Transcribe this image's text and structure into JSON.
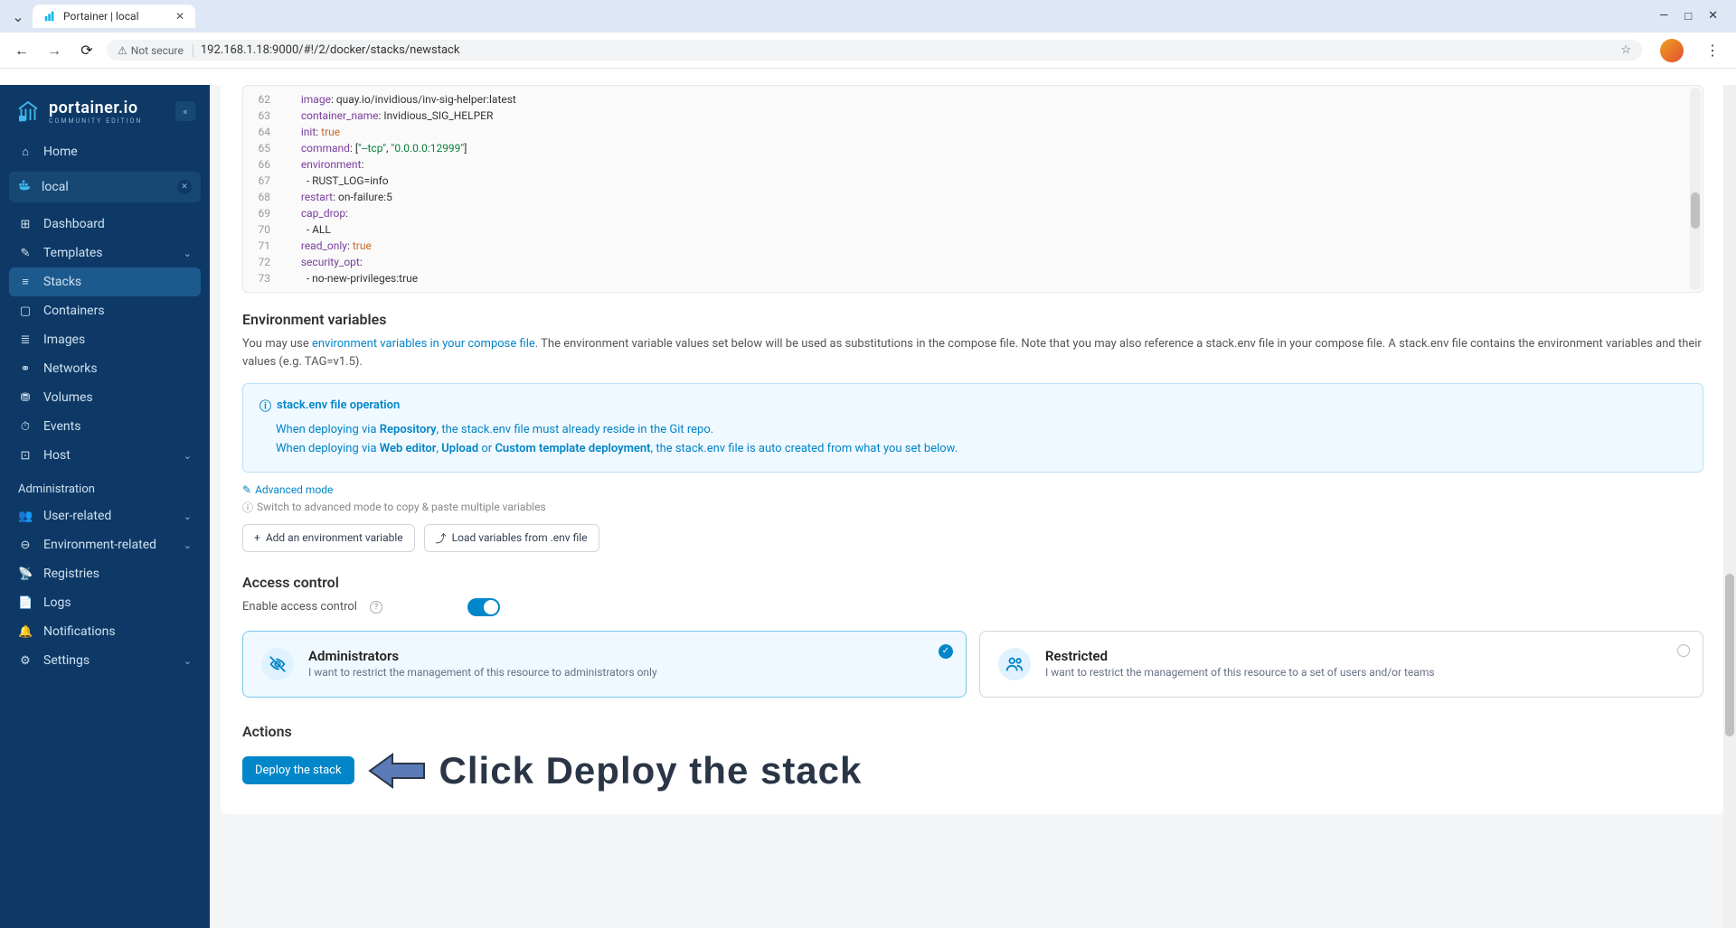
{
  "browser": {
    "tab_title": "Portainer | local",
    "not_secure": "Not secure",
    "url": "192.168.1.18:9000/#!/2/docker/stacks/newstack"
  },
  "sidebar": {
    "logo_main": "portainer.io",
    "logo_sub": "COMMUNITY EDITION",
    "home": "Home",
    "env_name": "local",
    "items": [
      {
        "icon": "⊞",
        "label": "Dashboard"
      },
      {
        "icon": "✎",
        "label": "Templates",
        "chev": true
      },
      {
        "icon": "≡",
        "label": "Stacks",
        "active": true
      },
      {
        "icon": "▢",
        "label": "Containers"
      },
      {
        "icon": "≣",
        "label": "Images"
      },
      {
        "icon": "⚭",
        "label": "Networks"
      },
      {
        "icon": "⛃",
        "label": "Volumes"
      },
      {
        "icon": "⏱",
        "label": "Events"
      },
      {
        "icon": "⊡",
        "label": "Host",
        "chev": true
      }
    ],
    "admin_label": "Administration",
    "admin_items": [
      {
        "icon": "👥",
        "label": "User-related",
        "chev": true
      },
      {
        "icon": "⊖",
        "label": "Environment-related",
        "chev": true
      },
      {
        "icon": "📡",
        "label": "Registries"
      },
      {
        "icon": "📄",
        "label": "Logs"
      },
      {
        "icon": "🔔",
        "label": "Notifications"
      },
      {
        "icon": "⚙",
        "label": "Settings",
        "chev": true
      }
    ]
  },
  "editor": {
    "lines": [
      {
        "n": 62,
        "indent": 3,
        "k": "image",
        "v_str": "quay.io/invidious/inv-sig-helper:latest"
      },
      {
        "n": 63,
        "indent": 3,
        "k": "container_name",
        "v_str": "Invidious_SIG_HELPER"
      },
      {
        "n": 64,
        "indent": 3,
        "k": "init",
        "v_bool": "true"
      },
      {
        "n": 65,
        "indent": 3,
        "k": "command",
        "v_raw": "[\"--tcp\", \"0.0.0.0:12999\"]"
      },
      {
        "n": 66,
        "indent": 3,
        "k": "environment",
        "colon_only": true
      },
      {
        "n": 67,
        "indent": 4,
        "dash": true,
        "plain": "RUST_LOG=info"
      },
      {
        "n": 68,
        "indent": 3,
        "k": "restart",
        "v_str": "on-failure:5"
      },
      {
        "n": 69,
        "indent": 3,
        "k": "cap_drop",
        "colon_only": true
      },
      {
        "n": 70,
        "indent": 4,
        "dash": true,
        "plain": "ALL"
      },
      {
        "n": 71,
        "indent": 3,
        "k": "read_only",
        "v_bool": "true"
      },
      {
        "n": 72,
        "indent": 3,
        "k": "security_opt",
        "colon_only": true
      },
      {
        "n": 73,
        "indent": 4,
        "dash": true,
        "plain": "no-new-privileges:true"
      }
    ]
  },
  "env_section": {
    "title": "Environment variables",
    "desc_prefix": "You may use ",
    "desc_link": "environment variables in your compose file",
    "desc_suffix": ". The environment variable values set below will be used as substitutions in the compose file. Note that you may also reference a stack.env file in your compose file. A stack.env file contains the environment variables and their values (e.g. TAG=v1.5).",
    "info_title": "stack.env file operation",
    "info_line1_a": "When deploying via ",
    "info_line1_b": "Repository",
    "info_line1_c": ", the stack.env file must already reside in the Git repo.",
    "info_line2_a": "When deploying via ",
    "info_line2_b": "Web editor",
    "info_line2_c": ", ",
    "info_line2_d": "Upload",
    "info_line2_e": " or ",
    "info_line2_f": "Custom template deployment",
    "info_line2_g": ", the stack.env file is auto created from what you set below.",
    "advanced_link": "Advanced mode",
    "advanced_hint": "Switch to advanced mode to copy & paste multiple variables",
    "btn_add": "Add an environment variable",
    "btn_load": "Load variables from .env file"
  },
  "access": {
    "title": "Access control",
    "enable_label": "Enable access control",
    "card_admin_title": "Administrators",
    "card_admin_desc": "I want to restrict the management of this resource to administrators only",
    "card_restricted_title": "Restricted",
    "card_restricted_desc": "I want to restrict the management of this resource to a set of users and/or teams"
  },
  "actions": {
    "title": "Actions",
    "deploy_label": "Deploy the stack"
  },
  "annotation": {
    "text": "Click Deploy the stack"
  }
}
